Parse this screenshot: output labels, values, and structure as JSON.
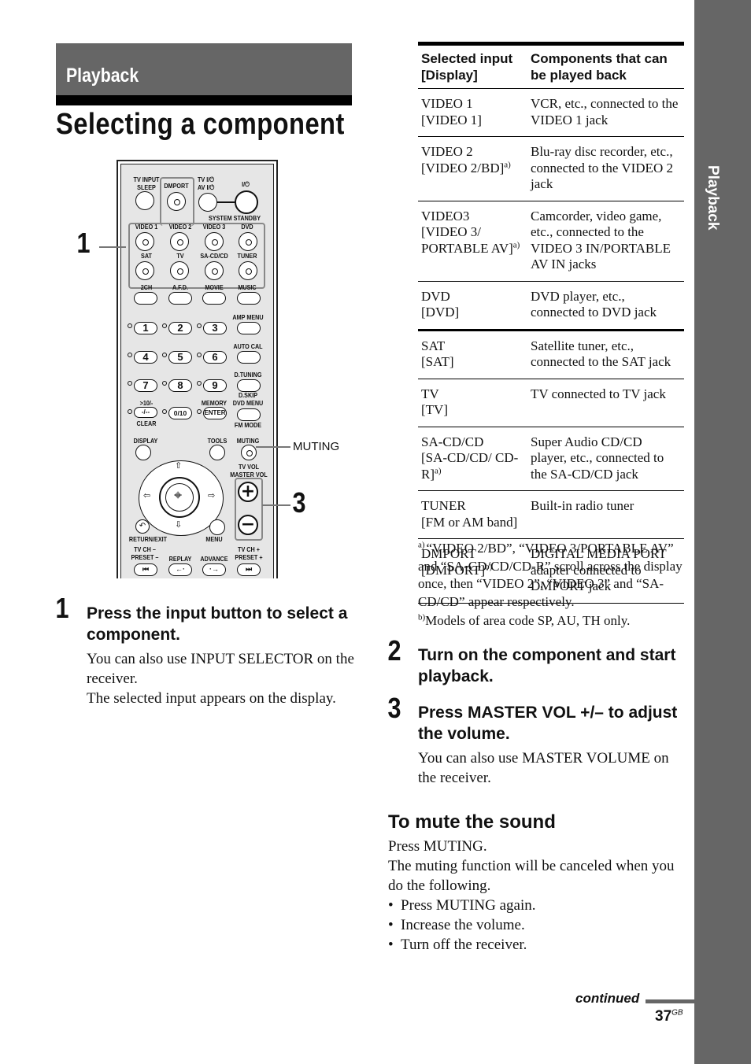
{
  "section": {
    "label": "Playback",
    "side_tab": "Playback"
  },
  "page_title": "Selecting a component",
  "remote": {
    "callouts": {
      "one": "1",
      "three": "3",
      "muting": "MUTING"
    },
    "labels": {
      "tv_input_sleep": "TV INPUT\nSLEEP",
      "dmport": "DMPORT",
      "tv_av_power": "TV I/⏻\nAV I/⏻",
      "power": "I/⏻",
      "system_standby": "SYSTEM STANDBY",
      "video1": "VIDEO 1",
      "video2": "VIDEO 2",
      "video3": "VIDEO 3",
      "dvd": "DVD",
      "sat": "SAT",
      "tv": "TV",
      "sacd": "SA-CD/CD",
      "tuner": "TUNER",
      "ch2": "2CH",
      "afd": "A.F.D.",
      "movie": "MOVIE",
      "music": "MUSIC",
      "amp_menu": "AMP MENU",
      "auto_cal": "AUTO CAL",
      "d_tuning": "D.TUNING",
      "d_skip": "D.SKIP\nDVD MENU",
      "fm_mode": "FM MODE",
      "ten": ">10/-",
      "clear": "CLEAR",
      "memory": "MEMORY",
      "display": "DISPLAY",
      "tools": "TOOLS",
      "muting": "MUTING",
      "tv_vol": "TV VOL\nMASTER VOL",
      "return_exit": "RETURN/EXIT",
      "menu": "MENU",
      "tv_ch_minus": "TV CH –\nPRESET –",
      "replay": "REPLAY",
      "advance": "ADVANCE",
      "tv_ch_plus": "TV CH +\nPRESET +"
    },
    "digits": [
      "1",
      "2",
      "3",
      "4",
      "5",
      "6",
      "7",
      "8",
      "9"
    ],
    "dash_key": "-/--",
    "zero_key": "0/10",
    "enter_key": "ENTER"
  },
  "steps": [
    {
      "num": "1",
      "heading": "Press the input button to select a component.",
      "body": [
        "You can also use INPUT SELECTOR on the receiver.",
        "The selected input appears on the display."
      ]
    },
    {
      "num": "2",
      "heading": "Turn on the component and start playback.",
      "body": []
    },
    {
      "num": "3",
      "heading": "Press MASTER VOL +/– to adjust the volume.",
      "body": [
        "You can also use MASTER VOLUME on the receiver."
      ]
    }
  ],
  "table": {
    "headers": [
      "Selected input [Display]",
      "Components that can be played back"
    ],
    "rows": [
      {
        "input": "VIDEO 1",
        "display": "[VIDEO 1]",
        "note": "",
        "desc": "VCR, etc., connected to the VIDEO 1 jack"
      },
      {
        "input": "VIDEO 2",
        "display": "[VIDEO 2/BD]",
        "note": "a)",
        "desc": "Blu-ray disc recorder, etc., connected to the VIDEO 2 jack"
      },
      {
        "input": "VIDEO3",
        "display": "[VIDEO 3/ PORTABLE AV]",
        "note": "a)",
        "desc": "Camcorder, video game, etc., connected to the VIDEO 3 IN/PORTABLE AV IN jacks"
      },
      {
        "input": "DVD",
        "display": "[DVD]",
        "note": "",
        "desc": "DVD player, etc., connected to DVD jack"
      },
      {
        "input": "SAT",
        "display": "[SAT]",
        "note": "",
        "desc": "Satellite tuner, etc., connected to the SAT jack"
      },
      {
        "input": "TV",
        "display": "[TV]",
        "note": "",
        "desc": "TV connected to TV jack"
      },
      {
        "input": "SA-CD/CD",
        "display": "[SA-CD/CD/ CD-R]",
        "note": "a)",
        "desc": "Super Audio CD/CD player, etc., connected to the SA-CD/CD jack"
      },
      {
        "input": "TUNER",
        "display": "[FM or AM band]",
        "note": "",
        "desc": "Built-in radio tuner"
      },
      {
        "input": "DMPORT",
        "display": "[DMPORT]",
        "note": "b)",
        "desc": "DIGITAL MEDIA PORT adapter connected to DMPORT jack"
      }
    ]
  },
  "footnotes": [
    {
      "mark": "a)",
      "text": "“VIDEO 2/BD”, “VIDEO 3/PORTABLE AV” and “SA-CD/CD/CD-R” scroll across the display once, then “VIDEO 2”, “VIDEO 3” and “SA-CD/CD” appear respectively."
    },
    {
      "mark": "b)",
      "text": "Models of area code SP, AU, TH only."
    }
  ],
  "mute": {
    "heading": "To mute the sound",
    "lines": [
      "Press MUTING.",
      "The muting function will be canceled when you do the following."
    ],
    "bullets": [
      "Press MUTING again.",
      "Increase the volume.",
      "Turn off the receiver."
    ]
  },
  "footer": {
    "continued": "continued",
    "page": "37",
    "suffix": "GB"
  }
}
